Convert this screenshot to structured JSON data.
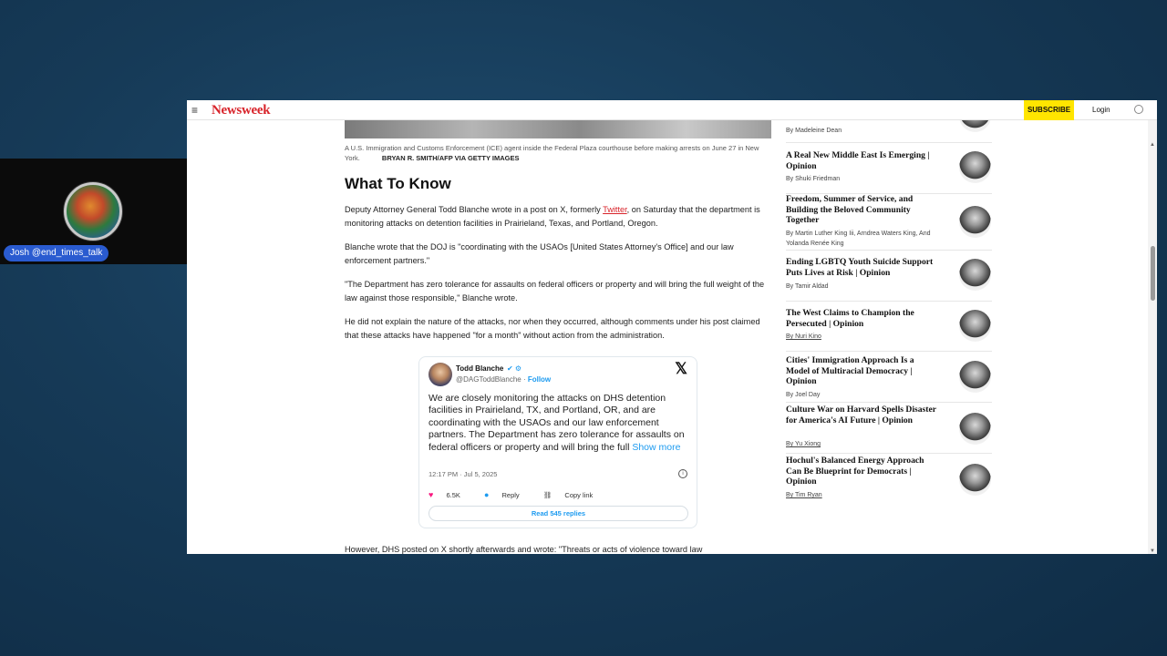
{
  "stream": {
    "name_tag": "Josh @end_times_talk"
  },
  "nav": {
    "logo": "Newsweek",
    "subscribe": "SUBSCRIBE",
    "login": "Login"
  },
  "article": {
    "caption": "A U.S. Immigration and Customs Enforcement (ICE) agent inside the Federal Plaza courthouse before making arrests on June 27 in New York.",
    "credit": "BRYAN R. SMITH/AFP VIA GETTY IMAGES",
    "heading": "What To Know",
    "p1_before": "Deputy Attorney General Todd Blanche wrote in a post on X, formerly ",
    "p1_link": "Twitter",
    "p1_after": ", on Saturday that the department is monitoring attacks on detention facilities in Prairieland, Texas, and Portland, Oregon.",
    "p2": "Blanche wrote that the DOJ is \"coordinating with the USAOs [United States Attorney's Office] and our law enforcement partners.\"",
    "p3": "\"The Department has zero tolerance for assaults on federal officers or property and will bring the full weight of the law against those responsible,\" Blanche wrote.",
    "p4": "He did not explain the nature of the attacks, nor when they occurred, although comments under his post claimed that these attacks have happened \"for a month\" without action from the administration.",
    "p5": "However, DHS posted on X shortly afterwards and wrote: \"Threats or acts of violence toward law"
  },
  "tweet": {
    "name": "Todd Blanche",
    "handle": "@DAGToddBlanche",
    "follow": "Follow",
    "text": "We are closely monitoring the attacks on DHS detention facilities in Prairieland, TX, and Portland, OR, and are coordinating with the USAOs and our law enforcement partners. The Department has zero tolerance for assaults on federal officers or property and will bring the full",
    "show_more": "Show more",
    "time": "12:17 PM · Jul 5, 2025",
    "likes": "6.5K",
    "reply": "Reply",
    "copy": "Copy link",
    "read_replies": "Read 545 replies"
  },
  "sidebar": {
    "items": [
      {
        "title": "",
        "author": "By Madeleine Dean"
      },
      {
        "title": "A Real New Middle East Is Emerging | Opinion",
        "author": "By Shuki Friedman"
      },
      {
        "title": "Freedom, Summer of Service, and Building the Beloved Community Together",
        "author": "By Martin Luther King Iii, Arndrea Waters King, And Yolanda Renée King"
      },
      {
        "title": "Ending LGBTQ Youth Suicide Support Puts Lives at Risk | Opinion",
        "author": "By Tamir Aldad"
      },
      {
        "title": "The West Claims to Champion the Persecuted | Opinion",
        "author": "By Nuri Kino"
      },
      {
        "title": "Cities' Immigration Approach Is a Model of Multiracial Democracy | Opinion",
        "author": "By Joel Day"
      },
      {
        "title": "Culture War on Harvard Spells Disaster for America's AI Future | Opinion",
        "author": "By Yu Xiong"
      },
      {
        "title": "Hochul's Balanced Energy Approach Can Be Blueprint for Democrats | Opinion",
        "author": "By Tim Ryan"
      }
    ]
  }
}
